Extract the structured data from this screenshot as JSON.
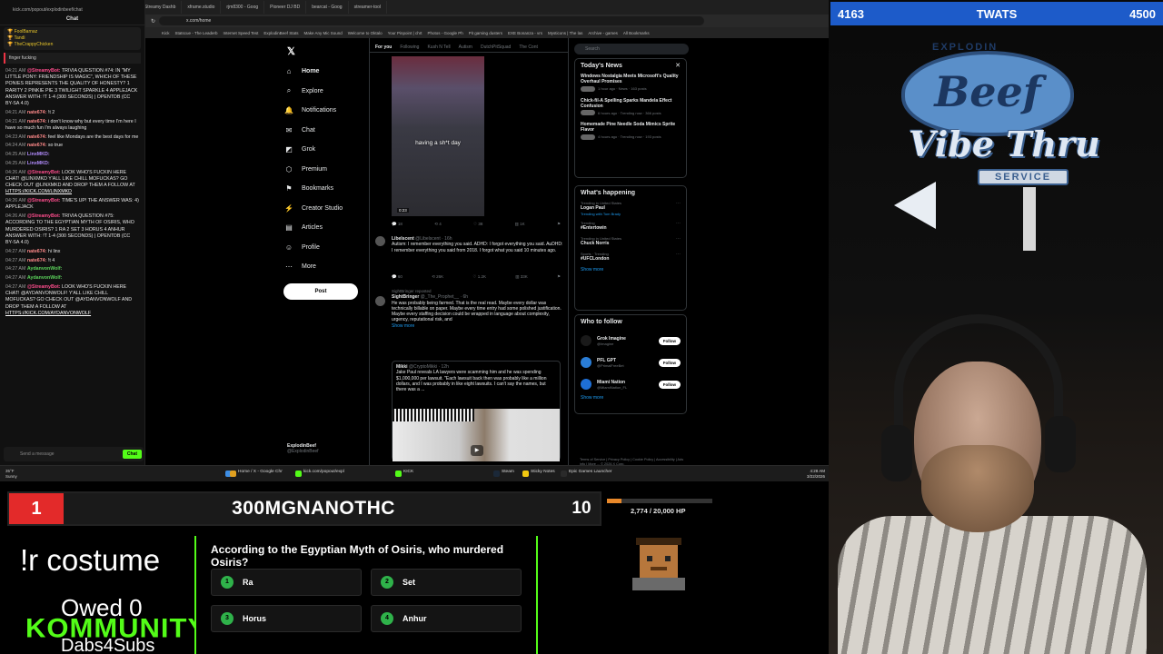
{
  "overlay": {
    "top_left_count": "4163",
    "top_title": "TWATS",
    "top_right_count": "4500",
    "rank": "1",
    "rank_name": "300MGNANOTHC",
    "rank_score": "10",
    "hp_text": "2,774 / 20,000 HP",
    "hp_fraction": 0.139,
    "command": "!r costume",
    "owed": "Owed 0",
    "community": "KOMMUNITY",
    "dabs": "Dabs4Subs",
    "logo_top": "EXPLODIN",
    "logo_main": "Beef",
    "logo_vibe": "Vibe Thru",
    "logo_service": "SERVICE"
  },
  "trivia": {
    "question": "According to the Egyptian Myth of Osiris, who murdered Osiris?",
    "answers": [
      {
        "num": "1",
        "text": "Ra"
      },
      {
        "num": "2",
        "text": "Set"
      },
      {
        "num": "3",
        "text": "Horus"
      },
      {
        "num": "4",
        "text": "Anhur"
      }
    ]
  },
  "browser": {
    "tabs": [
      "Home / X",
      "Notifications / X",
      "Home / X",
      "Kickstr.app",
      "Streamy Dashb",
      "xframe.studio",
      "rjm8300 - Goog",
      "Pioneer DJ BD",
      "bearcat - Goog",
      "streamer-tool"
    ],
    "url": "x.com/home",
    "bookmarks": [
      "Kick",
      "Statscue - The Leaderb",
      "Internet Speed Test",
      "ExplodinBeef Stats",
      "Make Any Mic Sound",
      "Welcome to Oktalo",
      "Your Pinpoint | chrt",
      "Photos - Google Ph",
      "Pit gaming dusters",
      "EXE Bonanza - vrs",
      "Mysticons | The las",
      "Archive - games",
      "All Bookmarks"
    ]
  },
  "kick_chat": {
    "url": "kick.com/popout/explodinbeef/chat",
    "title": "Chat",
    "pinned_1": "FoolBarnaz",
    "pinned_2": "Tandi",
    "pinned_3": "TheCrappyChicken",
    "reply_label": "finger fucking",
    "input_placeholder": "Send a message",
    "send_label": "Chat",
    "messages": [
      {
        "ts": "04:21 AM",
        "user": "@StreamyBot:",
        "cls": "u1",
        "text": "TRIVIA QUESTION #74: IN \"MY LITTLE PONY: FRIENDSHIP IS MAGIC\", WHICH OF THESE PONIES REPRESENTS THE QUALITY OF HONESTY? 1 RARITY 2 PINKIE PIE 3 TWILIGHT SPARKLE 4 APPLEJACK ANSWER WITH: !T 1-4 (300 SECONDS) | OPENTDB (CC BY-SA 4.0)"
      },
      {
        "ts": "04:21 AM",
        "user": "nate674:",
        "cls": "u2",
        "text": "!t 2"
      },
      {
        "ts": "04:21 AM",
        "user": "nate674:",
        "cls": "u2",
        "text": "i don't know why but every time I'm here I have so much fun I'm always laughing"
      },
      {
        "ts": "04:23 AM",
        "user": "nate674:",
        "cls": "u2",
        "text": "feel like Mondays are the best days for me"
      },
      {
        "ts": "04:24 AM",
        "user": "nate674:",
        "cls": "u2",
        "text": "so true"
      },
      {
        "ts": "04:25 AM",
        "user": "LinxMKD:",
        "cls": "u3",
        "text": ""
      },
      {
        "ts": "04:25 AM",
        "user": "LinxMKD:",
        "cls": "u3",
        "text": ""
      },
      {
        "ts": "04:26 AM",
        "user": "@StreamyBot:",
        "cls": "u1",
        "text": "LOOK WHO'S FUCKIN HERE CHAT! @LINXMKD Y'ALL LIKE CHILL MOFUCKAS? GO CHECK OUT @LINXMKD AND DROP THEM A FOLLOW AT",
        "link": "HTTPS://KICK.COM/LINXMKD"
      },
      {
        "ts": "04:26 AM",
        "user": "@StreamyBot:",
        "cls": "u1",
        "text": "TIME'S UP! THE ANSWER WAS: 4) APPLEJACK"
      },
      {
        "ts": "04:26 AM",
        "user": "@StreamyBot:",
        "cls": "u1",
        "text": "TRIVIA QUESTION #75: ACCORDING TO THE EGYPTIAN MYTH OF OSIRIS, WHO MURDERED OSIRIS? 1 RA 2 SET 3 HORUS 4 ANHUR ANSWER WITH: !T 1-4 (300 SECONDS) | OPENTDB (CC BY-SA 4.0)"
      },
      {
        "ts": "04:27 AM",
        "user": "nate674:",
        "cls": "u2",
        "text": "hi linx"
      },
      {
        "ts": "04:27 AM",
        "user": "nate674:",
        "cls": "u2",
        "text": "!t 4"
      },
      {
        "ts": "04:27 AM",
        "user": "AydanvonWolf:",
        "cls": "u4",
        "text": ""
      },
      {
        "ts": "04:27 AM",
        "user": "AydanvonWolf:",
        "cls": "u4",
        "text": ""
      },
      {
        "ts": "04:27 AM",
        "user": "@StreamyBot:",
        "cls": "u1",
        "text": "LOOK WHO'S FUCKIN HERE CHAT! @AYDANVONWOLF! Y'ALL LIKE CHILL MOFUCKAS? GO CHECK OUT @AYDANVONWOLF AND DROP THEM A FOLLOW AT",
        "link": "HTTPS://KICK.COM/AYDANVONWOLF"
      }
    ]
  },
  "x": {
    "nav": [
      {
        "icon": "⌂",
        "label": "Home",
        "name": "home"
      },
      {
        "icon": "⌕",
        "label": "Explore",
        "name": "explore"
      },
      {
        "icon": "🔔",
        "label": "Notifications",
        "name": "notifications"
      },
      {
        "icon": "✉",
        "label": "Chat",
        "name": "chat"
      },
      {
        "icon": "◩",
        "label": "Grok",
        "name": "grok"
      },
      {
        "icon": "⬡",
        "label": "Premium",
        "name": "premium"
      },
      {
        "icon": "⚑",
        "label": "Bookmarks",
        "name": "bookmarks"
      },
      {
        "icon": "⚡",
        "label": "Creator Studio",
        "name": "creator-studio"
      },
      {
        "icon": "▤",
        "label": "Articles",
        "name": "articles"
      },
      {
        "icon": "☺",
        "label": "Profile",
        "name": "profile"
      },
      {
        "icon": "⋯",
        "label": "More",
        "name": "more"
      }
    ],
    "post_label": "Post",
    "account_name": "ExplodinBeef",
    "account_handle": "@ExplodinBeef",
    "feed_tabs": [
      "For you",
      "Following",
      "Kush N Tell",
      "Autism",
      "DutchPitSquad",
      "The Cont"
    ],
    "video_caption": "having a sh*t day",
    "video_duration": "0:23",
    "video_actions": [
      "18",
      "4",
      "38",
      "1K"
    ],
    "tweet1": {
      "name": "Libelscent",
      "handle": "@Libelscent · 16h",
      "text": "Autism: I remember everything you said. ADHD: I forgot everything you said. AuDHD: I remember everything you said from 2018. I forgot what you said 10 minutes ago.",
      "actions": [
        "60",
        "26K",
        "1.2K",
        "33K"
      ]
    },
    "tweet2": {
      "repost": "SightBringer reposted",
      "name": "SightBringer",
      "handle": "@_The_Prophet__ · 6h",
      "text": "He was probably being farmed. That is the real read. Maybe every dollar was technically billable on paper. Maybe every time entry had some polished justification. Maybe every staffing decision could be wrapped in language about complexity, urgency, reputational risk, and",
      "show_more": "Show more"
    },
    "quote": {
      "name": "Mikki",
      "handle": "@CryptoMikki · 12h",
      "text": "Jake Paul reveals LA lawyers were scamming him and he was spending $1,000,000 per lawsuit. \"Each lawsuit back then was probably like a million dollars, and I was probably in like eight lawsuits. I can't say the names, but there was a ..."
    },
    "search_placeholder": "Search",
    "news_title": "Today's News",
    "news": [
      {
        "title": "Windows Nostalgia Meets Microsoft's Quality Overhaul Promises",
        "meta": "1 hour ago · News · 163 posts"
      },
      {
        "title": "Chick-fil-A Spelling Sparks Mandela Effect Confusion",
        "meta": "6 hours ago · Trending now · 366 posts"
      },
      {
        "title": "Homemade Pine Needle Soda Mimics Sprite Flavor",
        "meta": "4 hours ago · Trending now · 193 posts"
      }
    ],
    "happening_title": "What's happening",
    "trends": [
      {
        "cat": "Trending in United States",
        "name": "Logan Paul",
        "sub": "Trending with Tom Brady"
      },
      {
        "cat": "Trending",
        "name": "#Entertowin",
        "sub": ""
      },
      {
        "cat": "Trending in United States",
        "name": "Chuck Norris",
        "sub": ""
      },
      {
        "cat": "Sports · Trending",
        "name": "#UFCLondon",
        "sub": ""
      }
    ],
    "show_more": "Show more",
    "wtf_title": "Who to follow",
    "wtf": [
      {
        "name": "Grok Imagine",
        "handle": "@Imagine",
        "color": "#1a1a1a"
      },
      {
        "name": "PFL GPT",
        "handle": "@PrimalFreeBet",
        "color": "#2a7dd6"
      },
      {
        "name": "Miami Nation",
        "handle": "@MiamiNation_FL",
        "color": "#1e6fd6"
      }
    ],
    "follow_label": "Follow",
    "footer": "Terms of Service | Privacy Policy | Cookie Policy | Accessibility | Ads info | More ... © 2026 X Corp."
  },
  "taskbar": {
    "weather_temp": "35°F",
    "weather_cond": "Sunny",
    "items": [
      "Home / X - Google Chr",
      "kick.com/popout/expl",
      "KICK",
      "Steam",
      "Sticky Notes",
      "Epic Games Launcher"
    ],
    "time": "4:28 AM",
    "date": "3/22/2026"
  }
}
